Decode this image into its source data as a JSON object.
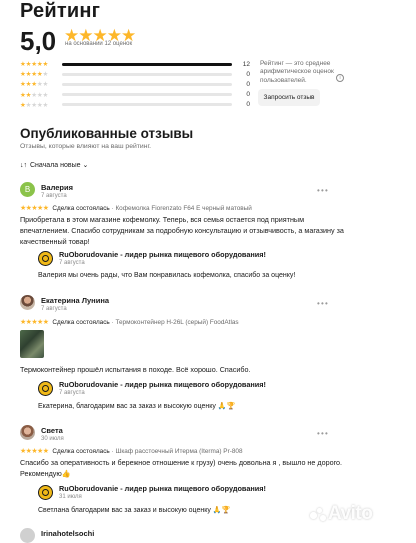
{
  "rating": {
    "title": "Рейтинг",
    "score": "5,0",
    "stars": "★★★★★",
    "based_on": "на основании 12 оценок",
    "distribution": [
      {
        "stars": 5,
        "count": "12",
        "fraction": 1.0
      },
      {
        "stars": 4,
        "count": "0",
        "fraction": 0
      },
      {
        "stars": 3,
        "count": "0",
        "fraction": 0
      },
      {
        "stars": 2,
        "count": "0",
        "fraction": 0
      },
      {
        "stars": 1,
        "count": "0",
        "fraction": 0
      }
    ],
    "note": "Рейтинг — это среднее арифметическое оценок пользователей.",
    "info_icon": "i",
    "request_button": "Запросить отзыв"
  },
  "published": {
    "title": "Опубликованные отзывы",
    "subtitle": "Отзывы, которые влияют на ваш рейтинг.",
    "sort_icon": "↓↑",
    "sort_label": "Сначала новые",
    "sort_chevron": "⌄"
  },
  "reviews": [
    {
      "avatar_letter": "В",
      "name": "Валерия",
      "date": "7 августа",
      "stars": "★★★★★",
      "deal": "Сделка состоялась",
      "item": " · Кофемолка Fiorenzato F64 E черный матовый",
      "text_lines": [
        "Приобретала в этом магазине кофемолку. Теперь, вся семья остается под приятным",
        "впечатлением. Спасибо сотрудникам за подробную консультацию и отзывчивость, а магазину за",
        "качественный товар!"
      ],
      "reply": {
        "shop": "RuOborudovanie - лидер рынка пищевого оборудования!",
        "date": "7 августа",
        "text": "Валерия мы очень рады, что Вам понравилась кофемолка, спасибо за оценку!"
      }
    },
    {
      "name": "Екатерина Лунина",
      "date": "7 августа",
      "stars": "★★★★★",
      "deal": "Сделка состоялась",
      "item": " · Термоконтейнер H-26L (серый) FoodAtlas",
      "text_lines": [
        "Термоконтейнер прошёл испытания в походе. Всё хорошо. Спасибо."
      ],
      "reply": {
        "shop": "RuOborudovanie - лидер рынка пищевого оборудования!",
        "date": "7 августа",
        "text": "Екатерина, благодарим вас за заказ и высокую оценку 🙏🏆"
      }
    },
    {
      "name": "Света",
      "date": "30 июля",
      "stars": "★★★★★",
      "deal": "Сделка состоялась",
      "item": " · Шкаф расстоечный Итерма (Iterma) Pr-808",
      "text_lines": [
        "Спасибо за оперативность и бережное отношение к грузу) очень довольна я , вышло не дорого.",
        "Рекомендую👍"
      ],
      "reply": {
        "shop": "RuOborudovanie - лидер рынка пищевого оборудования!",
        "date": "31 июля",
        "text": "Светлана благодарим вас за заказ и высокую оценку 🙏🏆"
      }
    },
    {
      "name": "Irinahotelsochi"
    }
  ],
  "more_icon": "• • •",
  "watermark": "Avito"
}
